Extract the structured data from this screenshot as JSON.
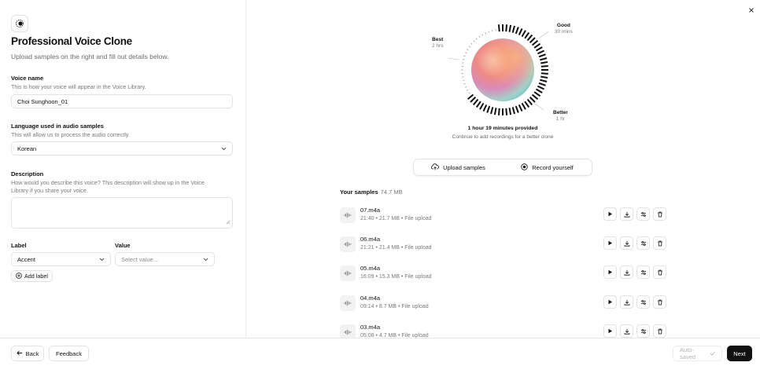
{
  "header": {
    "logo_icon": "voice-clone-icon",
    "title": "Professional Voice Clone",
    "subtitle": "Upload samples on the right and fill out details below."
  },
  "voice_name": {
    "label": "Voice name",
    "help": "This is how your voice will appear in the Voice Library.",
    "value": "Choi Sunghoon_01"
  },
  "language": {
    "label": "Language used in audio samples",
    "help": "This will allow us to process the audio correctly.",
    "value": "Korean"
  },
  "description": {
    "label": "Description",
    "help_line1": "How would you describe this voice? This description will show up in the Voice",
    "help_line2": "Library if you share your voice.",
    "value": ""
  },
  "labels": {
    "label_heading": "Label",
    "value_heading": "Value",
    "label_value": "Accent",
    "value_placeholder": "Select value...",
    "add_label": "Add label"
  },
  "visualizer": {
    "best_title": "Best",
    "best_sub": "2 hrs",
    "good_title": "Good",
    "good_sub": "30 mins",
    "better_title": "Better",
    "better_sub": "1 hr",
    "provided": "1 hour 19 minutes provided",
    "continue": "Continue to add recordings for a better clone",
    "progress_fraction": 0.66
  },
  "upload": {
    "upload_label": "Upload samples",
    "record_label": "Record yourself"
  },
  "samples": {
    "title": "Your samples",
    "total_size": "74.7 MB",
    "items": [
      {
        "name": "07.m4a",
        "meta": "21:40 • 21.7 MB • File upload"
      },
      {
        "name": "06.m4a",
        "meta": "21:21 • 21.4 MB • File upload"
      },
      {
        "name": "05.m4a",
        "meta": "16:09 • 15.3 MB • File upload"
      },
      {
        "name": "04.m4a",
        "meta": "09:14 • 8.7 MB • File upload"
      },
      {
        "name": "03.m4a",
        "meta": "05:08 • 4.7 MB • File upload"
      }
    ]
  },
  "footer": {
    "back": "Back",
    "feedback": "Feedback",
    "autosaved": "Auto-saved",
    "next": "Next"
  }
}
